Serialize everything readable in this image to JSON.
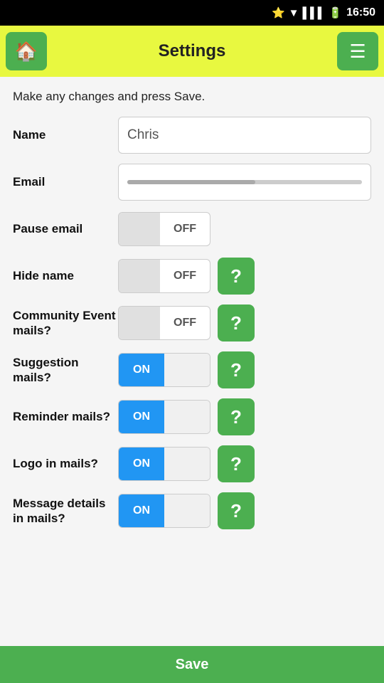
{
  "statusBar": {
    "time": "16:50"
  },
  "header": {
    "title": "Settings",
    "homeIcon": "🏠",
    "menuIcon": "☰"
  },
  "instruction": "Make any changes and press Save.",
  "fields": {
    "name": {
      "label": "Name",
      "value": "Chris",
      "placeholder": "Chris"
    },
    "email": {
      "label": "Email"
    },
    "pauseEmail": {
      "label": "Pause email",
      "state": "OFF"
    },
    "hideName": {
      "label": "Hide name",
      "state": "OFF"
    },
    "communityEventMails": {
      "label": "Community Event mails?",
      "state": "OFF"
    },
    "suggestionMails": {
      "label": "Suggestion mails?",
      "state": "ON"
    },
    "reminderMails": {
      "label": "Reminder mails?",
      "state": "ON"
    },
    "logoInMails": {
      "label": "Logo in mails?",
      "state": "ON"
    },
    "messageDetailsInMails": {
      "label": "Message details in mails?",
      "state": "ON"
    }
  },
  "saveButton": {
    "label": "Save"
  },
  "helpButton": {
    "label": "?"
  }
}
